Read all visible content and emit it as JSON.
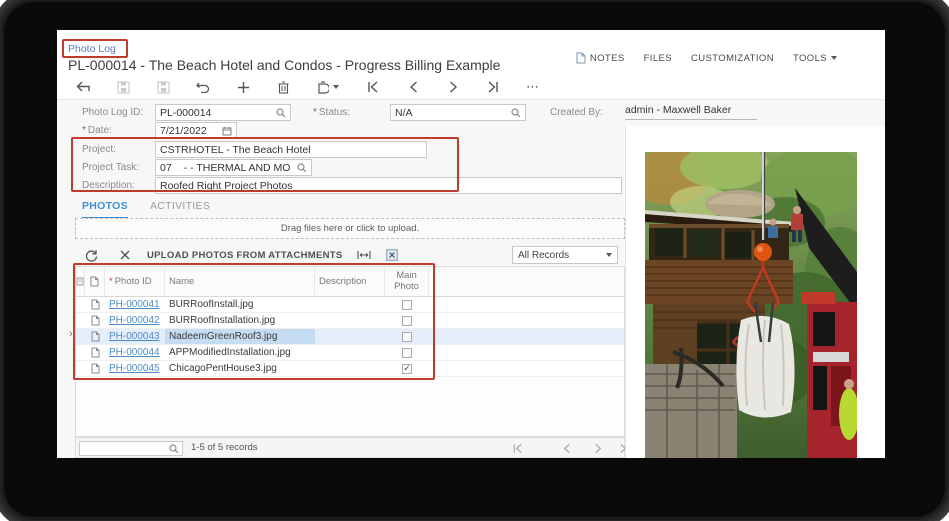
{
  "app": {
    "screen_link": "Photo Log"
  },
  "header": {
    "title": "PL-000014 - The Beach Hotel and Condos - Progress Billing Example",
    "menu": {
      "notes": "NOTES",
      "files": "FILES",
      "customization": "CUSTOMIZATION",
      "tools": "TOOLS"
    }
  },
  "form": {
    "photo_log_id": {
      "label": "Photo Log ID:",
      "value": "PL-000014"
    },
    "status": {
      "label": "Status:",
      "required": "*",
      "value": "N/A"
    },
    "created_by": {
      "label": "Created By:",
      "value": "admin - Maxwell Baker"
    },
    "date": {
      "label": "Date:",
      "required": "*",
      "value": "7/21/2022"
    },
    "project": {
      "label": "Project:",
      "value": "CSTRHOTEL - The Beach Hotel"
    },
    "project_task": {
      "label": "Project Task:",
      "code": "07",
      "value": "- - THERMAL AND MO"
    },
    "description": {
      "label": "Description:",
      "value": "Roofed Right Project Photos"
    }
  },
  "tabs": {
    "photos": "PHOTOS",
    "activities": "ACTIVITIES"
  },
  "dropzone": {
    "text": "Drag files here or click to upload."
  },
  "grid_toolbar": {
    "upload_label": "UPLOAD PHOTOS FROM ATTACHMENTS",
    "filter_value": "All Records"
  },
  "grid": {
    "columns": {
      "photo_id_mark": "*",
      "photo_id": "Photo ID",
      "name": "Name",
      "description": "Description",
      "main_photo": "Main Photo"
    },
    "rows": [
      {
        "photo_id": "PH-000041",
        "name": "BURRoofInstall.jpg",
        "description": "",
        "main_photo": false,
        "selected": false
      },
      {
        "photo_id": "PH-000042",
        "name": "BURRoofInstallation.jpg",
        "description": "",
        "main_photo": false,
        "selected": false
      },
      {
        "photo_id": "PH-000043",
        "name": "NadeemGreenRoof3.jpg",
        "description": "",
        "main_photo": false,
        "selected": true
      },
      {
        "photo_id": "PH-000044",
        "name": "APPModifiedInstallation.jpg",
        "description": "",
        "main_photo": false,
        "selected": false
      },
      {
        "photo_id": "PH-000045",
        "name": "ChicagoPentHouse3.jpg",
        "description": "",
        "main_photo": true,
        "selected": false
      }
    ]
  },
  "footer": {
    "records": "1-5 of 5 records",
    "search_value": ""
  },
  "photo_panel": {
    "description": "Crane with orange ball hook lifting white bag beside brown wooden house among green trees, red truck at right"
  },
  "colors": {
    "annotation": "#c13a2c",
    "accent_blue": "#3f8fd0",
    "link": "#4e8ac8"
  }
}
